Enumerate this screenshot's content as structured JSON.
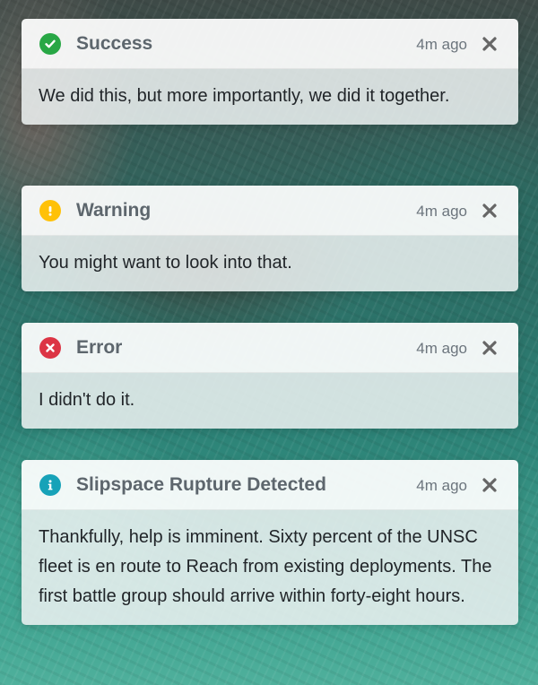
{
  "toasts": [
    {
      "type": "success",
      "icon": "check-circle-icon",
      "icon_color": "#28a745",
      "title": "Success",
      "time": "4m ago",
      "message": "We did this, but more importantly, we did it together."
    },
    {
      "type": "warning",
      "icon": "exclamation-circle-icon",
      "icon_color": "#ffc107",
      "title": "Warning",
      "time": "4m ago",
      "message": "You might want to look into that."
    },
    {
      "type": "error",
      "icon": "x-circle-icon",
      "icon_color": "#dc3545",
      "title": "Error",
      "time": "4m ago",
      "message": "I didn't do it."
    },
    {
      "type": "info",
      "icon": "info-circle-icon",
      "icon_color": "#17a2b8",
      "title": "Slipspace Rupture Detected",
      "time": "4m ago",
      "message": "Thankfully, help is imminent. Sixty percent of the UNSC fleet is en route to Reach from existing deployments. The first battle group should arrive within forty-eight hours."
    }
  ]
}
